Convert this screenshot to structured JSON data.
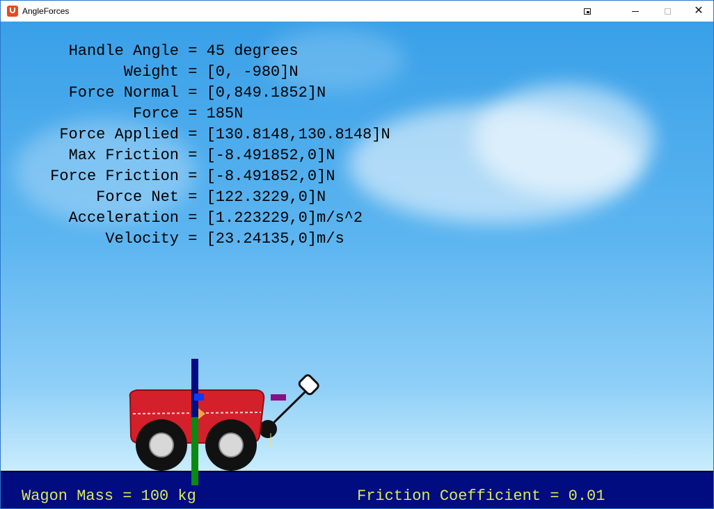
{
  "window": {
    "title": "AngleForces",
    "controls": {
      "restore": "restore-icon",
      "minimize": "minimize-icon",
      "maximize": "maximize-icon",
      "close": "✕"
    }
  },
  "stats": [
    {
      "label": "Handle Angle",
      "value": "45 degrees"
    },
    {
      "label": "Weight",
      "value": "[0, -980]N"
    },
    {
      "label": "Force Normal",
      "value": "[0,849.1852]N"
    },
    {
      "label": "Force",
      "value": "185N"
    },
    {
      "label": "Force Applied",
      "value": "[130.8148,130.8148]N"
    },
    {
      "label": "Max Friction",
      "value": "[-8.491852,0]N"
    },
    {
      "label": "Force Friction",
      "value": "[-8.491852,0]N"
    },
    {
      "label": "Force Net",
      "value": "[122.3229,0]N"
    },
    {
      "label": "Acceleration",
      "value": "[1.223229,0]m/s^2"
    },
    {
      "label": "Velocity",
      "value": "[23.24135,0]m/s"
    }
  ],
  "footer": {
    "mass": "Wagon Mass = 100 kg",
    "friction": "Friction Coefficient = 0.01"
  },
  "colors": {
    "sky_top": "#39a0e8",
    "ground": "#000c80",
    "footer_text": "#d9e85a",
    "wagon_body": "#d4202a",
    "normal_force": "#000c80",
    "weight_force": "#0a8a12",
    "friction_marker": "#0a3cff",
    "applied_marker": "#8a0e86"
  }
}
